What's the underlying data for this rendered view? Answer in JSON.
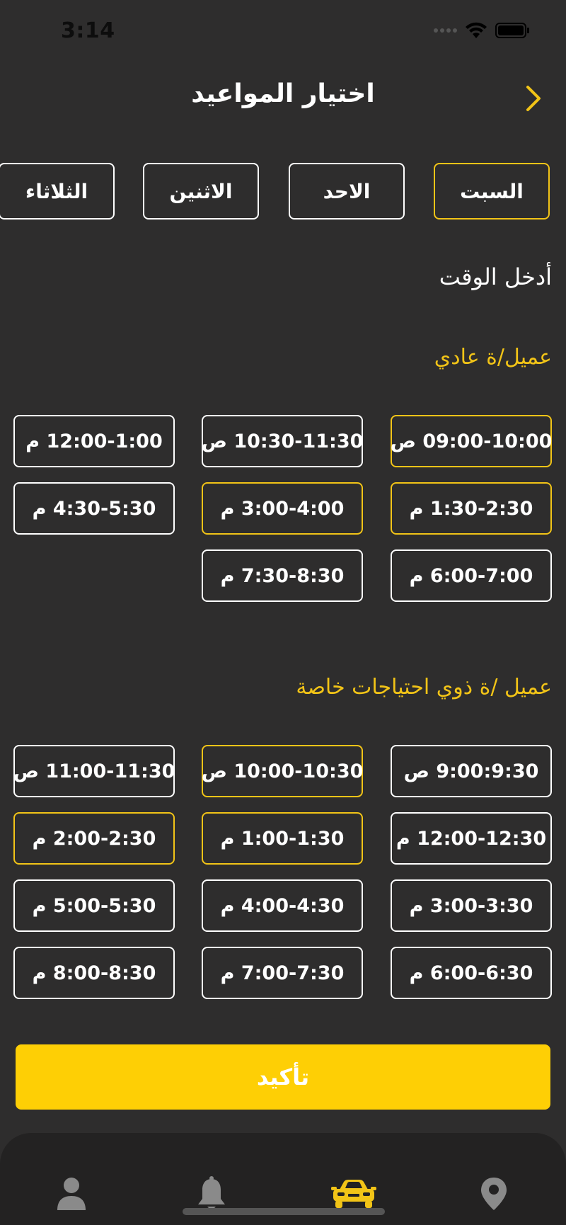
{
  "status": {
    "time": "3:14"
  },
  "header": {
    "title": "اختيار المواعيد"
  },
  "days": [
    {
      "label": "السبت",
      "selected": true
    },
    {
      "label": "الاحد",
      "selected": false
    },
    {
      "label": "الاثنين",
      "selected": false
    },
    {
      "label": "الثلاثاء",
      "selected": false
    }
  ],
  "enter_time_label": "أدخل الوقت",
  "regular": {
    "label": "عميل/ة عادي",
    "slots": [
      {
        "label": "09:00-10:00 ص",
        "selected": true
      },
      {
        "label": "10:30-11:30 ص",
        "selected": false
      },
      {
        "label": "12:00-1:00 م",
        "selected": false
      },
      {
        "label": "1:30-2:30 م",
        "selected": true
      },
      {
        "label": "3:00-4:00 م",
        "selected": true
      },
      {
        "label": "4:30-5:30 م",
        "selected": false
      },
      {
        "label": "6:00-7:00 م",
        "selected": false
      },
      {
        "label": "7:30-8:30 م",
        "selected": false
      }
    ]
  },
  "special": {
    "label": "عميل /ة ذوي احتياجات خاصة",
    "slots": [
      {
        "label": "9:00:9:30 ص",
        "selected": false
      },
      {
        "label": "10:00-10:30 ص",
        "selected": true
      },
      {
        "label": "11:00-11:30 ص",
        "selected": false
      },
      {
        "label": "12:00-12:30 م",
        "selected": false
      },
      {
        "label": "1:00-1:30 م",
        "selected": true
      },
      {
        "label": "2:00-2:30 م",
        "selected": true
      },
      {
        "label": "3:00-3:30 م",
        "selected": false
      },
      {
        "label": "4:00-4:30 م",
        "selected": false
      },
      {
        "label": "5:00-5:30 م",
        "selected": false
      },
      {
        "label": "6:00-6:30 م",
        "selected": false
      },
      {
        "label": "7:00-7:30 م",
        "selected": false
      },
      {
        "label": "8:00-8:30 م",
        "selected": false
      }
    ]
  },
  "confirm_label": "تأكيد",
  "tabbar": {
    "items": [
      {
        "icon": "location-pin-icon",
        "active": false
      },
      {
        "icon": "car-icon",
        "active": true
      },
      {
        "icon": "bell-icon",
        "active": false
      },
      {
        "icon": "person-icon",
        "active": false
      }
    ]
  },
  "colors": {
    "accent": "#f2c417",
    "button": "#fecf05",
    "background": "#2e2d2d",
    "inactive_icon": "#8a8a8a"
  }
}
